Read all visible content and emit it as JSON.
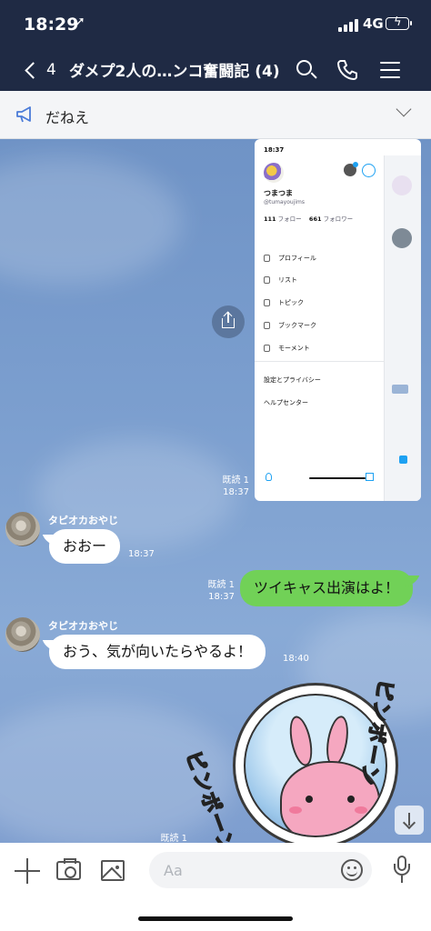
{
  "status_bar": {
    "time": "18:29",
    "network": "4G"
  },
  "header": {
    "back_count": "4",
    "title": "ダメプ2人の…ンコ奮闘記 (4)",
    "icons": [
      "search-icon",
      "phone-icon",
      "menu-icon"
    ]
  },
  "announcement": {
    "text": "だねえ"
  },
  "screenshot": {
    "time": "18:37",
    "profile_name": "つまつま",
    "profile_handle": "@tumayoujims",
    "following_count": "111",
    "following_label": "フォロー",
    "followers_count": "661",
    "followers_label": "フォロワー",
    "menu": [
      "プロフィール",
      "リスト",
      "トピック",
      "ブックマーク",
      "モーメント"
    ],
    "settings": "設定とプライバシー",
    "help": "ヘルプセンター"
  },
  "messages": [
    {
      "read": "既読 1",
      "time": "18:37"
    },
    {
      "sender": "タピオカおやじ",
      "text": "おおー",
      "time": "18:37"
    },
    {
      "read": "既読 1",
      "time": "18:37",
      "text": "ツイキャス出演はよ！"
    },
    {
      "sender": "タピオカおやじ",
      "text": "おう、気が向いたらやるよ！",
      "time": "18:40"
    },
    {
      "read": "既読 1"
    }
  ],
  "sticker": {
    "text_left": "ピンポーン",
    "text_right": "ピンポーン"
  },
  "input": {
    "placeholder": "Aa"
  },
  "colors": {
    "header_bg": "#1f2a44",
    "sent_bubble": "#71d157",
    "chat_bg": "#7c9fcf"
  }
}
